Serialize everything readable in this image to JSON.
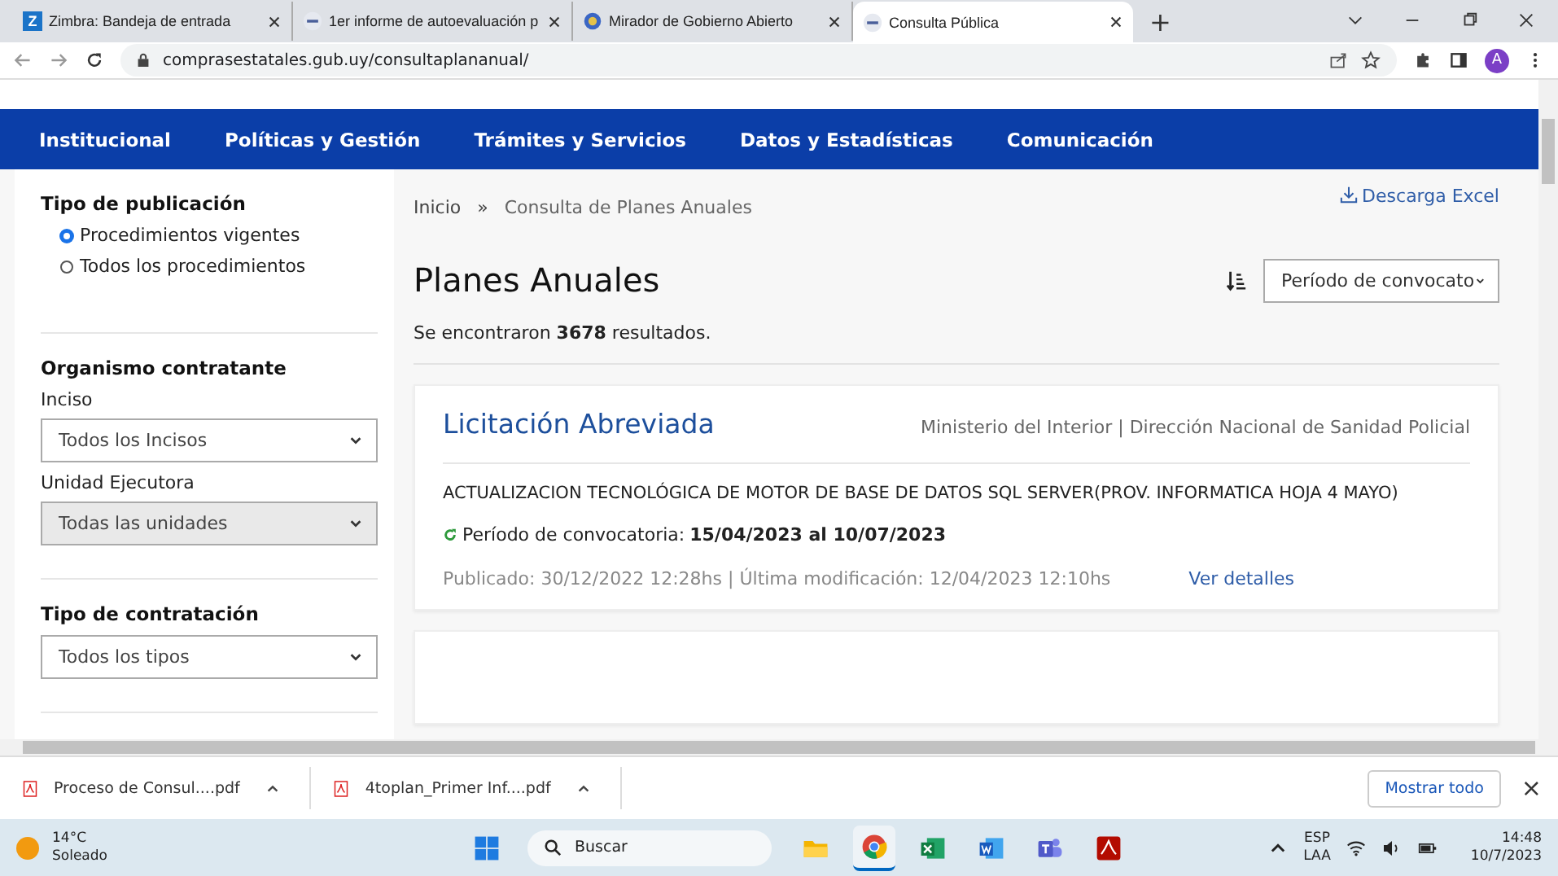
{
  "browser": {
    "tabs": [
      {
        "title": "Zimbra: Bandeja de entrada",
        "selected": false
      },
      {
        "title": "1er informe de autoevaluación p",
        "selected": false
      },
      {
        "title": "Mirador de Gobierno Abierto",
        "selected": false
      },
      {
        "title": "Consulta Pública",
        "selected": true
      }
    ],
    "tab_letter": "Z",
    "new_tab": "+",
    "url": "comprasestatales.gub.uy/consultaplananual/",
    "profile": "A"
  },
  "nav": [
    "Institucional",
    "Políticas y Gestión",
    "Trámites y Servicios",
    "Datos y Estadísticas",
    "Comunicación"
  ],
  "sidebar": {
    "sections": [
      {
        "title": "Tipo de publicación",
        "kind": "radios",
        "options": [
          {
            "label": "Procedimientos vigentes",
            "selected": true
          },
          {
            "label": "Todos los procedimientos",
            "selected": false
          }
        ]
      },
      {
        "title": "Organismo contratante",
        "kind": "selects",
        "fields": [
          {
            "label": "Inciso",
            "value": "Todos los Incisos",
            "disabled": false
          },
          {
            "label": "Unidad Ejecutora",
            "value": "Todas las unidades",
            "disabled": true
          }
        ]
      },
      {
        "title": "Tipo de contratación",
        "kind": "selects",
        "fields": [
          {
            "value": "Todos los tipos",
            "disabled": false
          }
        ]
      }
    ]
  },
  "breadcrumb": [
    "Inicio",
    "»",
    "Consulta de Planes Anuales"
  ],
  "excel_link": "Descarga Excel",
  "heading": "Planes Anuales",
  "sort_select": "Período de convocato",
  "results": "Se encontraron **3678** resultados.",
  "cards": [
    {
      "title": "Licitación Abreviada",
      "organism": "Ministerio del Interior | Dirección Nacional de Sanidad Policial",
      "description": "ACTUALIZACION TECNOLÓGICA DE MOTOR DE BASE DE DATOS SQL SERVER(PROV. INFORMATICA HOJA 4 MAYO)",
      "period_label": "Período de convocatoria:",
      "period": "15/04/2023 al 10/07/2023",
      "meta": "Publicado: 30/12/2022 12:28hs | Última modificación: 12/04/2023 12:10hs",
      "details_link": "Ver detalles"
    }
  ],
  "downloads": {
    "files": [
      "Proceso de Consul....pdf",
      "4toplan_Primer Inf....pdf"
    ],
    "show_all": "Mostrar todo",
    "close": "×"
  },
  "taskbar": {
    "temperature": "14°C",
    "weather": "Soleado",
    "search": "Buscar",
    "apps": [
      {
        "kind": "folder",
        "selected": false
      },
      {
        "kind": "browser",
        "selected": true
      },
      {
        "kind": "spreadsheet",
        "selected": false
      },
      {
        "kind": "document",
        "selected": false
      },
      {
        "kind": "chat",
        "selected": false
      },
      {
        "kind": "pdf",
        "selected": false
      }
    ],
    "lang": "ESP",
    "layout": "LAA",
    "time": "14:48",
    "date": "10/7/2023"
  }
}
